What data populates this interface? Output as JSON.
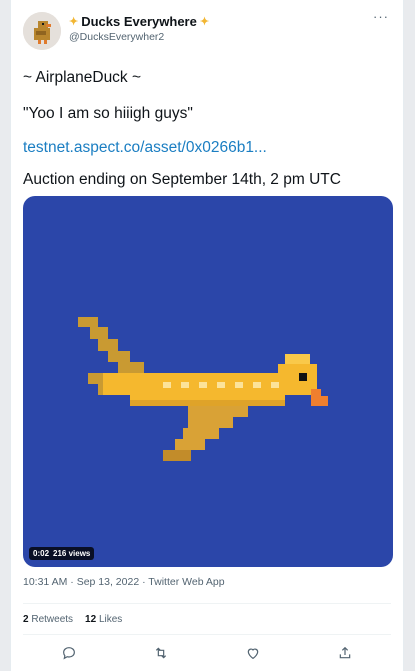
{
  "author": {
    "display_name": "Ducks Everywhere",
    "handle": "@DucksEverywher2",
    "badge_icon": "sparkle-icon",
    "avatar_icon": "duck-avatar-icon"
  },
  "tweet": {
    "line1": "~ AirplaneDuck ~",
    "line2": "\"Yoo I am so hiiigh guys\"",
    "link": "testnet.aspect.co/asset/0x0266b1...",
    "line3": "Auction ending on September 14th, 2 pm UTC"
  },
  "media": {
    "duration": "0:02",
    "views": "216 views",
    "background_color": "#2b46a9"
  },
  "meta": {
    "time_source": "10:31 AM · Sep 13, 2022 · Twitter Web App"
  },
  "stats": {
    "retweets_count": "2",
    "retweets_label": "Retweets",
    "likes_count": "12",
    "likes_label": "Likes"
  },
  "actions": [
    {
      "name": "reply",
      "icon": "reply-icon"
    },
    {
      "name": "retweet",
      "icon": "retweet-icon"
    },
    {
      "name": "like",
      "icon": "heart-icon"
    },
    {
      "name": "share",
      "icon": "share-icon"
    }
  ],
  "colors": {
    "link": "#1b7ec2",
    "secondary_text": "#536471"
  }
}
